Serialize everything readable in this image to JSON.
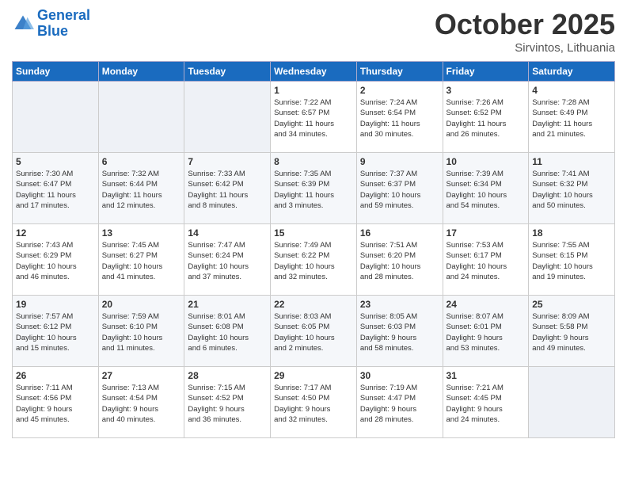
{
  "header": {
    "logo_line1": "General",
    "logo_line2": "Blue",
    "month": "October 2025",
    "location": "Sirvintos, Lithuania"
  },
  "weekdays": [
    "Sunday",
    "Monday",
    "Tuesday",
    "Wednesday",
    "Thursday",
    "Friday",
    "Saturday"
  ],
  "weeks": [
    [
      {
        "day": "",
        "info": ""
      },
      {
        "day": "",
        "info": ""
      },
      {
        "day": "",
        "info": ""
      },
      {
        "day": "1",
        "info": "Sunrise: 7:22 AM\nSunset: 6:57 PM\nDaylight: 11 hours\nand 34 minutes."
      },
      {
        "day": "2",
        "info": "Sunrise: 7:24 AM\nSunset: 6:54 PM\nDaylight: 11 hours\nand 30 minutes."
      },
      {
        "day": "3",
        "info": "Sunrise: 7:26 AM\nSunset: 6:52 PM\nDaylight: 11 hours\nand 26 minutes."
      },
      {
        "day": "4",
        "info": "Sunrise: 7:28 AM\nSunset: 6:49 PM\nDaylight: 11 hours\nand 21 minutes."
      }
    ],
    [
      {
        "day": "5",
        "info": "Sunrise: 7:30 AM\nSunset: 6:47 PM\nDaylight: 11 hours\nand 17 minutes."
      },
      {
        "day": "6",
        "info": "Sunrise: 7:32 AM\nSunset: 6:44 PM\nDaylight: 11 hours\nand 12 minutes."
      },
      {
        "day": "7",
        "info": "Sunrise: 7:33 AM\nSunset: 6:42 PM\nDaylight: 11 hours\nand 8 minutes."
      },
      {
        "day": "8",
        "info": "Sunrise: 7:35 AM\nSunset: 6:39 PM\nDaylight: 11 hours\nand 3 minutes."
      },
      {
        "day": "9",
        "info": "Sunrise: 7:37 AM\nSunset: 6:37 PM\nDaylight: 10 hours\nand 59 minutes."
      },
      {
        "day": "10",
        "info": "Sunrise: 7:39 AM\nSunset: 6:34 PM\nDaylight: 10 hours\nand 54 minutes."
      },
      {
        "day": "11",
        "info": "Sunrise: 7:41 AM\nSunset: 6:32 PM\nDaylight: 10 hours\nand 50 minutes."
      }
    ],
    [
      {
        "day": "12",
        "info": "Sunrise: 7:43 AM\nSunset: 6:29 PM\nDaylight: 10 hours\nand 46 minutes."
      },
      {
        "day": "13",
        "info": "Sunrise: 7:45 AM\nSunset: 6:27 PM\nDaylight: 10 hours\nand 41 minutes."
      },
      {
        "day": "14",
        "info": "Sunrise: 7:47 AM\nSunset: 6:24 PM\nDaylight: 10 hours\nand 37 minutes."
      },
      {
        "day": "15",
        "info": "Sunrise: 7:49 AM\nSunset: 6:22 PM\nDaylight: 10 hours\nand 32 minutes."
      },
      {
        "day": "16",
        "info": "Sunrise: 7:51 AM\nSunset: 6:20 PM\nDaylight: 10 hours\nand 28 minutes."
      },
      {
        "day": "17",
        "info": "Sunrise: 7:53 AM\nSunset: 6:17 PM\nDaylight: 10 hours\nand 24 minutes."
      },
      {
        "day": "18",
        "info": "Sunrise: 7:55 AM\nSunset: 6:15 PM\nDaylight: 10 hours\nand 19 minutes."
      }
    ],
    [
      {
        "day": "19",
        "info": "Sunrise: 7:57 AM\nSunset: 6:12 PM\nDaylight: 10 hours\nand 15 minutes."
      },
      {
        "day": "20",
        "info": "Sunrise: 7:59 AM\nSunset: 6:10 PM\nDaylight: 10 hours\nand 11 minutes."
      },
      {
        "day": "21",
        "info": "Sunrise: 8:01 AM\nSunset: 6:08 PM\nDaylight: 10 hours\nand 6 minutes."
      },
      {
        "day": "22",
        "info": "Sunrise: 8:03 AM\nSunset: 6:05 PM\nDaylight: 10 hours\nand 2 minutes."
      },
      {
        "day": "23",
        "info": "Sunrise: 8:05 AM\nSunset: 6:03 PM\nDaylight: 9 hours\nand 58 minutes."
      },
      {
        "day": "24",
        "info": "Sunrise: 8:07 AM\nSunset: 6:01 PM\nDaylight: 9 hours\nand 53 minutes."
      },
      {
        "day": "25",
        "info": "Sunrise: 8:09 AM\nSunset: 5:58 PM\nDaylight: 9 hours\nand 49 minutes."
      }
    ],
    [
      {
        "day": "26",
        "info": "Sunrise: 7:11 AM\nSunset: 4:56 PM\nDaylight: 9 hours\nand 45 minutes."
      },
      {
        "day": "27",
        "info": "Sunrise: 7:13 AM\nSunset: 4:54 PM\nDaylight: 9 hours\nand 40 minutes."
      },
      {
        "day": "28",
        "info": "Sunrise: 7:15 AM\nSunset: 4:52 PM\nDaylight: 9 hours\nand 36 minutes."
      },
      {
        "day": "29",
        "info": "Sunrise: 7:17 AM\nSunset: 4:50 PM\nDaylight: 9 hours\nand 32 minutes."
      },
      {
        "day": "30",
        "info": "Sunrise: 7:19 AM\nSunset: 4:47 PM\nDaylight: 9 hours\nand 28 minutes."
      },
      {
        "day": "31",
        "info": "Sunrise: 7:21 AM\nSunset: 4:45 PM\nDaylight: 9 hours\nand 24 minutes."
      },
      {
        "day": "",
        "info": ""
      }
    ]
  ]
}
